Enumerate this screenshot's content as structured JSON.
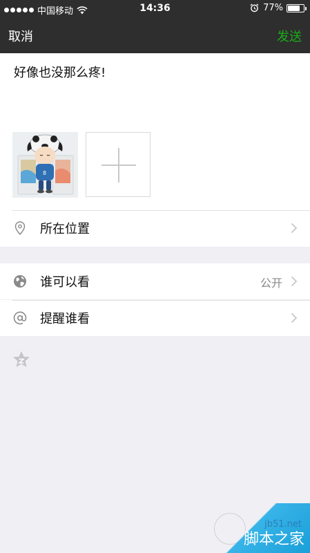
{
  "status_bar": {
    "carrier": "中国移动",
    "time": "14:36",
    "battery_percent": "77%",
    "battery_level": 0.77,
    "icons": [
      "signal-dots-icon",
      "wifi-icon",
      "alarm-icon",
      "battery-icon"
    ]
  },
  "navbar": {
    "cancel_label": "取消",
    "send_label": "发送",
    "send_color": "#1aad19"
  },
  "compose": {
    "text": "好像也没那么疼!",
    "images": [
      "photo-thumbnail"
    ],
    "add_photo_icon": "plus-icon"
  },
  "rows": {
    "location": {
      "label": "所在位置",
      "icon": "location-pin-icon"
    },
    "visibility": {
      "label": "谁可以看",
      "value": "公开",
      "icon": "globe-icon"
    },
    "mention": {
      "label": "提醒谁看",
      "icon": "at-icon"
    }
  },
  "footer_icon": "star-icon",
  "watermark": {
    "url": "jb51.net",
    "name": "脚本之家"
  },
  "colors": {
    "bar_bg": "#2e2e2e",
    "accent_green": "#1aad19",
    "page_bg": "#efeff4"
  }
}
